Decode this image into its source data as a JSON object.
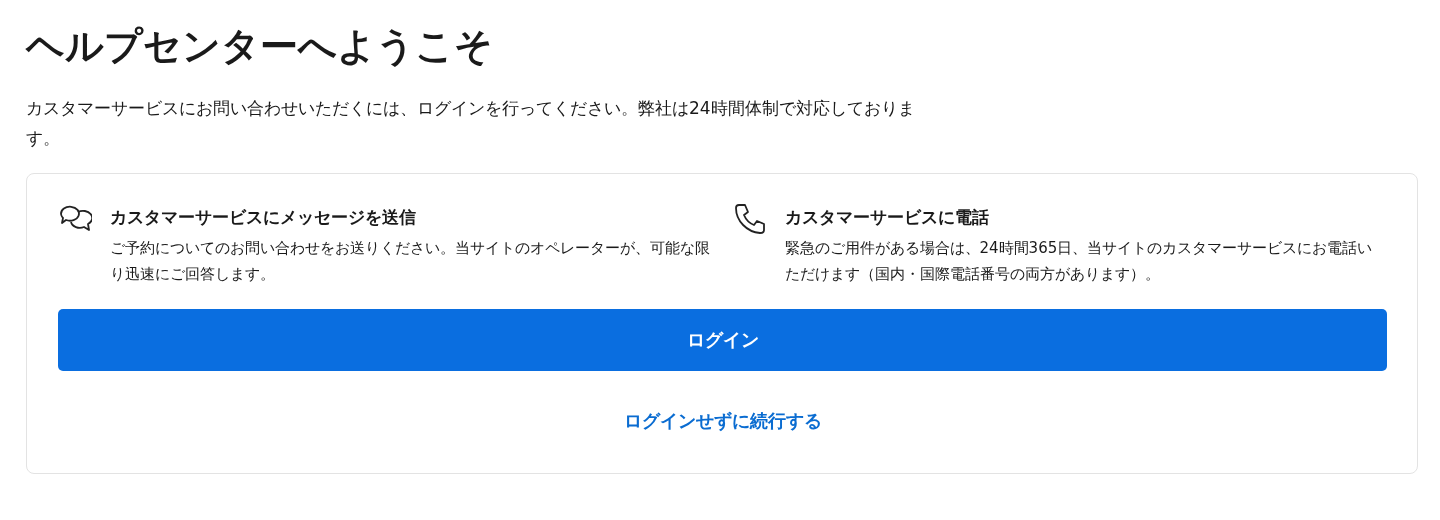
{
  "title": "ヘルプセンターへようこそ",
  "intro": "カスタマーサービスにお問い合わせいただくには、ログインを行ってください。弊社は24時間体制で対応しております。",
  "options": [
    {
      "kind": "message",
      "heading": "カスタマーサービスにメッセージを送信",
      "text": "ご予約についてのお問い合わせをお送りください。当サイトのオペレーターが、可能な限り迅速にご回答します。"
    },
    {
      "kind": "phone",
      "heading": "カスタマーサービスに電話",
      "text": "緊急のご用件がある場合は、24時間365日、当サイトのカスタマーサービスにお電話いただけます（国内・国際電話番号の両方があります）。"
    }
  ],
  "login_button": "ログイン",
  "continue_link": "ログインせずに続行する"
}
